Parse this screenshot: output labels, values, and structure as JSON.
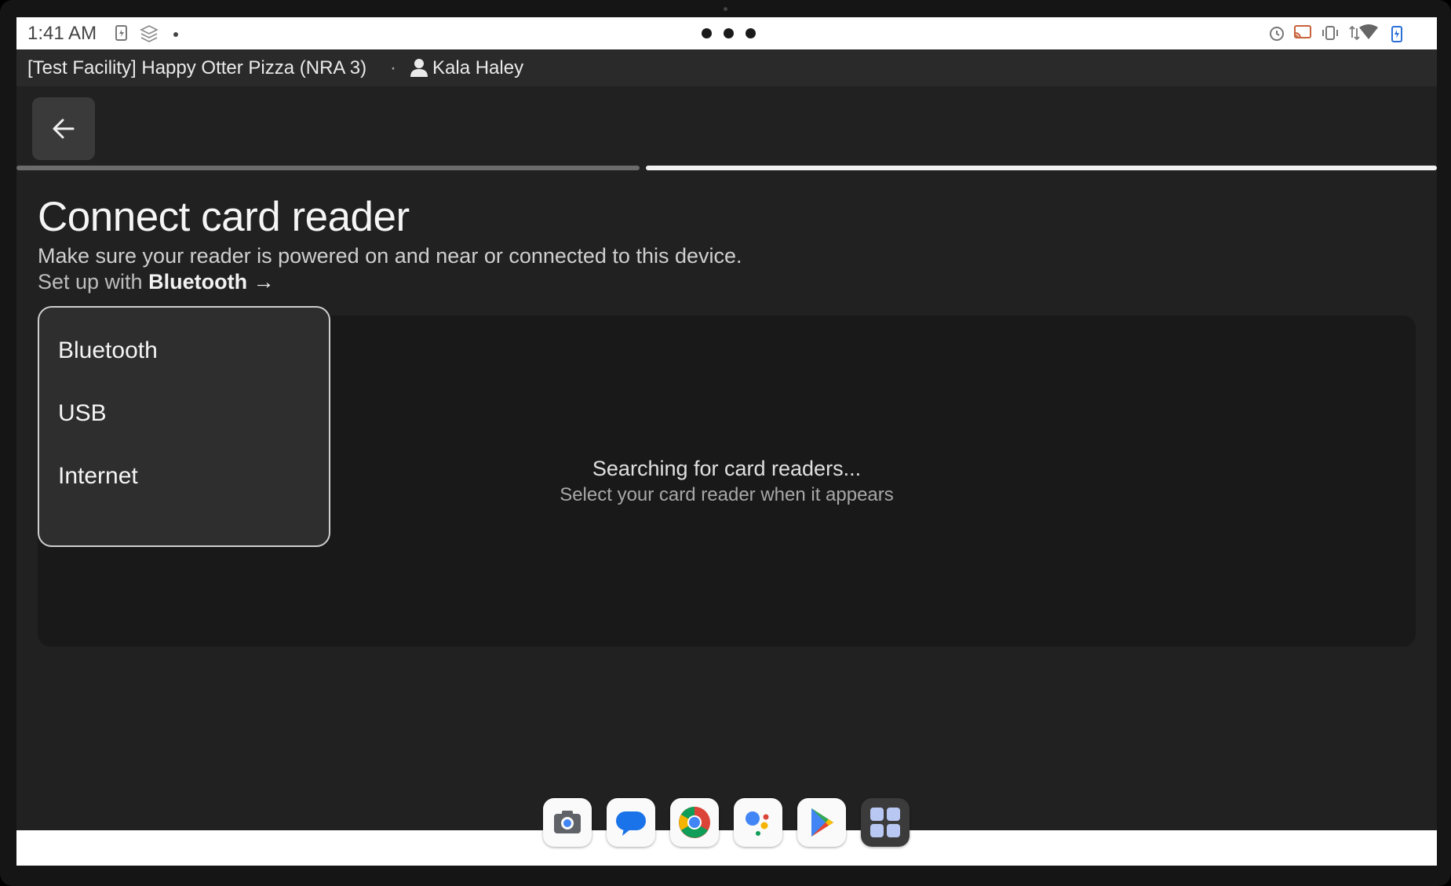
{
  "status_bar": {
    "time": "1:41 AM"
  },
  "app_bar": {
    "facility": "[Test Facility] Happy Otter Pizza (NRA 3)",
    "separator": "·",
    "user": "Kala Haley"
  },
  "page": {
    "title": "Connect card reader",
    "subtitle": "Make sure your reader is powered on and near or connected to this device.",
    "setup_prefix": "Set up with",
    "setup_method": "Bluetooth",
    "setup_arrow": "→"
  },
  "connection_menu": {
    "items": [
      "Bluetooth",
      "USB",
      "Internet"
    ]
  },
  "search": {
    "title": "Searching for card readers...",
    "subtitle": "Select your card reader when it appears"
  },
  "progress": {
    "steps_total": 2,
    "current_step": 2
  },
  "dock": {
    "apps": [
      "camera-app",
      "messages-app",
      "chrome-app",
      "assistant-app",
      "play-store-app",
      "apps-grid"
    ]
  },
  "colors": {
    "background": "#212121",
    "app_bar": "#2a2a2a",
    "panel": "#191919",
    "menu": "#2e2e2e"
  }
}
